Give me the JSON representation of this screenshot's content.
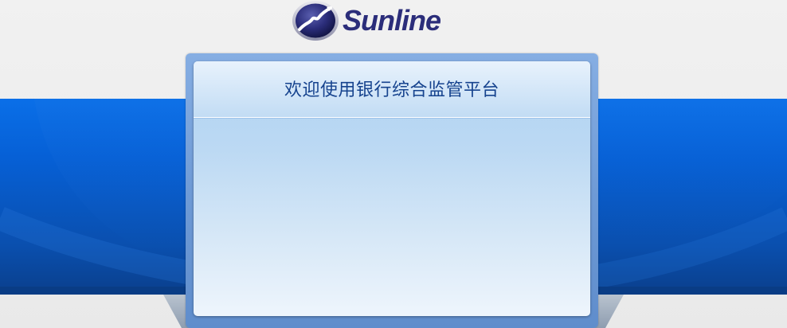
{
  "logo": {
    "brand_name": "Sunline",
    "mark_icon": "swoosh-globe-icon",
    "brand_color": "#2b2d7a"
  },
  "panel": {
    "title": "欢迎使用银行综合监管平台",
    "title_color": "#16438e"
  },
  "colors": {
    "band_blue": "#0660d6",
    "panel_border": "#6f9bd6",
    "page_background": "#ececec"
  }
}
